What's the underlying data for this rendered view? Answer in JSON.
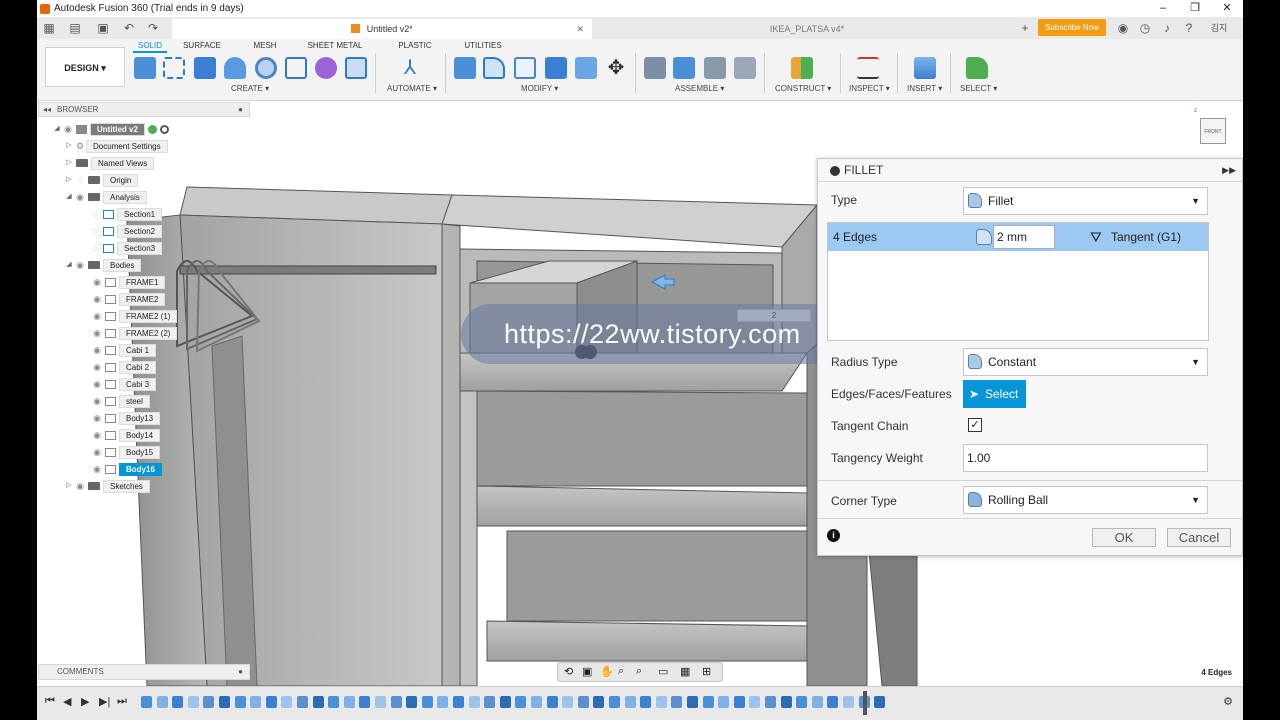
{
  "window": {
    "title": "Autodesk Fusion 360 (Trial ends in 9 days)",
    "controls": [
      "–",
      "❐",
      "✕"
    ]
  },
  "tabs": {
    "active_doc": "Untitled v2*",
    "inactive_doc": "IKEA_PLATSA v4*",
    "subscribe_label": "Subscribe Now",
    "user_label": "김지"
  },
  "toolbar": {
    "design_label": "DESIGN",
    "mode_tabs": [
      "SOLID",
      "SURFACE",
      "MESH",
      "SHEET METAL",
      "PLASTIC",
      "UTILITIES"
    ],
    "active_mode": "SOLID",
    "groups": [
      "CREATE",
      "AUTOMATE",
      "MODIFY",
      "ASSEMBLE",
      "CONSTRUCT",
      "INSPECT",
      "INSERT",
      "SELECT"
    ]
  },
  "browser": {
    "header": "BROWSER",
    "items": [
      {
        "label": "Untitled v2",
        "kind": "root"
      },
      {
        "label": "Document Settings",
        "kind": "folder"
      },
      {
        "label": "Named Views",
        "kind": "folder"
      },
      {
        "label": "Origin",
        "kind": "folder"
      },
      {
        "label": "Analysis",
        "kind": "folder"
      },
      {
        "label": "Section1",
        "kind": "item"
      },
      {
        "label": "Section2",
        "kind": "item"
      },
      {
        "label": "Section3",
        "kind": "item"
      },
      {
        "label": "Bodies",
        "kind": "folder"
      },
      {
        "label": "FRAME1",
        "kind": "body"
      },
      {
        "label": "FRAME2",
        "kind": "body"
      },
      {
        "label": "FRAME2 (1)",
        "kind": "body"
      },
      {
        "label": "FRAME2 (2)",
        "kind": "body"
      },
      {
        "label": "Cabi 1",
        "kind": "body"
      },
      {
        "label": "Cabi 2",
        "kind": "body"
      },
      {
        "label": "Cabi 3",
        "kind": "body"
      },
      {
        "label": "steel",
        "kind": "body"
      },
      {
        "label": "Body13",
        "kind": "body"
      },
      {
        "label": "Body14",
        "kind": "body"
      },
      {
        "label": "Body15",
        "kind": "body"
      },
      {
        "label": "Body16",
        "kind": "selected"
      },
      {
        "label": "Sketches",
        "kind": "folder"
      }
    ]
  },
  "fillet": {
    "title": "FILLET",
    "type_label": "Type",
    "type_value": "Fillet",
    "edges_label": "4 Edges",
    "radius_value": "2 mm",
    "continuity_value": "Tangent (G1)",
    "radius_type_label": "Radius Type",
    "radius_type_value": "Constant",
    "edges_faces_label": "Edges/Faces/Features",
    "select_label": "Select",
    "tangent_chain_label": "Tangent Chain",
    "tangent_chain_checked": true,
    "tangency_weight_label": "Tangency Weight",
    "tangency_weight_value": "1.00",
    "corner_type_label": "Corner Type",
    "corner_type_value": "Rolling Ball",
    "ok_label": "OK",
    "cancel_label": "Cancel"
  },
  "viewport": {
    "watermark": "https://22ww.tistory.com",
    "mini_input_value": "2",
    "status_text": "4 Edges"
  },
  "comments_label": "COMMENTS",
  "colors": {
    "accent": "#0696d7",
    "subscribe": "#f39c12",
    "edge_highlight": "#9cc9f2"
  }
}
